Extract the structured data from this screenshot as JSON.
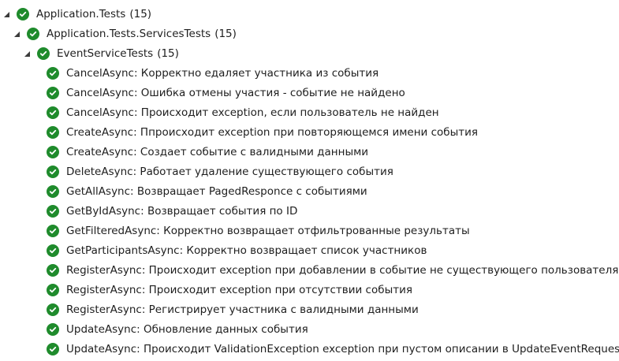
{
  "colors": {
    "passed": "#1f8b2c",
    "text": "#1e1e1e",
    "background": "#ffffff"
  },
  "root": {
    "name": "Application.Tests",
    "count": "(15)",
    "status_icon": "check-circle-icon",
    "expanded": true
  },
  "namespace": {
    "name": "Application.Tests.ServicesTests",
    "count": "(15)",
    "status_icon": "check-circle-icon",
    "expanded": true
  },
  "class": {
    "name": "EventServiceTests",
    "count": "(15)",
    "status_icon": "check-circle-icon",
    "expanded": true
  },
  "tests": [
    {
      "label": "CancelAsync: Корректно едаляет участника из события",
      "status": "passed"
    },
    {
      "label": "CancelAsync: Ошибка отмены участия - событие не найдено",
      "status": "passed"
    },
    {
      "label": "CancelAsync: Происходит exception, если пользователь не найден",
      "status": "passed"
    },
    {
      "label": "CreateAsync: Ппроисходит exception при повторяющемся имени события",
      "status": "passed"
    },
    {
      "label": "CreateAsync: Создает событие с валидными данными",
      "status": "passed"
    },
    {
      "label": "DeleteAsync: Работает удаление существующего события",
      "status": "passed"
    },
    {
      "label": "GetAllAsync: Возвращает PagedResponce с событиями",
      "status": "passed"
    },
    {
      "label": "GetByIdAsync: Возвращает события по ID",
      "status": "passed"
    },
    {
      "label": "GetFilteredAsync: Корректно возвращает отфильтрованные результаты",
      "status": "passed"
    },
    {
      "label": "GetParticipantsAsync: Корректно возвращает список участников",
      "status": "passed"
    },
    {
      "label": "RegisterAsync: Происходит exception при добавлении в событие не существующего пользователя",
      "status": "passed"
    },
    {
      "label": "RegisterAsync: Происходит exception при отсутствии события",
      "status": "passed"
    },
    {
      "label": "RegisterAsync: Регистрирует участника с валидными данными",
      "status": "passed"
    },
    {
      "label": "UpdateAsync: Обновление данных события",
      "status": "passed"
    },
    {
      "label": "UpdateAsync: Происходит ValidationException exception при пустом описании в UpdateEventRequest",
      "status": "passed"
    }
  ]
}
